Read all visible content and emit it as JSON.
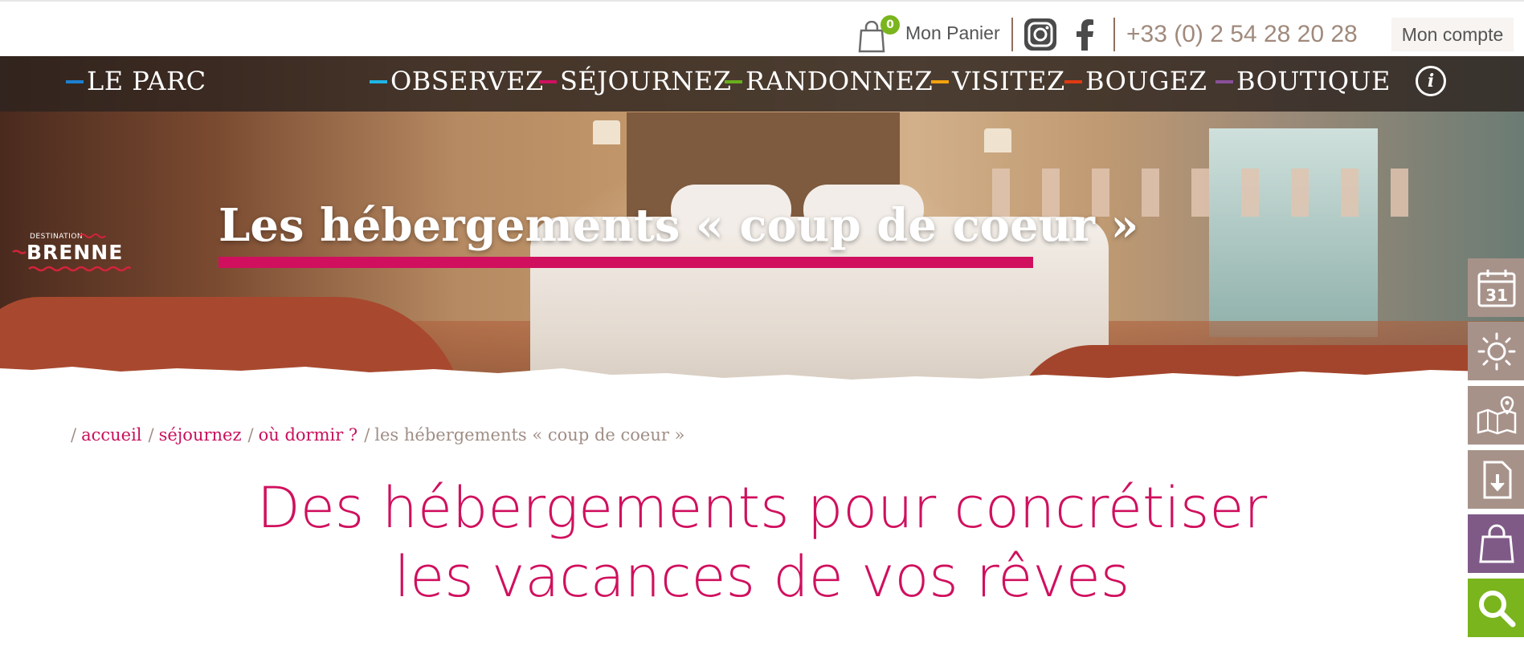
{
  "topbar": {
    "cart_count": "0",
    "cart_label": "Mon Panier",
    "social": [
      "instagram-icon",
      "facebook-icon"
    ],
    "phone": "+33 (0) 2 54 28 20 28",
    "account_label": "Mon compte"
  },
  "nav": {
    "items": [
      {
        "label": "LE PARC",
        "color": "#1c7fd1"
      },
      {
        "label": "OBSERVEZ",
        "color": "#1fb5e6"
      },
      {
        "label": "SÉJOURNEZ",
        "color": "#d0105e"
      },
      {
        "label": "RANDONNEZ",
        "color": "#6aad1c"
      },
      {
        "label": "VISITEZ",
        "color": "#f2a20d"
      },
      {
        "label": "BOUGEZ",
        "color": "#e03a12"
      },
      {
        "label": "BOUTIQUE",
        "color": "#8a4f9a"
      }
    ],
    "info_label": "i"
  },
  "logo": {
    "small": "DESTINATION",
    "big": "BRENNE"
  },
  "hero": {
    "title": "Les hébergements «  coup de coeur  »"
  },
  "breadcrumb": {
    "items": [
      "accueil",
      "séjournez",
      "où dormir ?"
    ],
    "current": "les hébergements «  coup de coeur  »"
  },
  "heading": {
    "line1": "Des hébergements pour concrétiser",
    "line2": "les vacances de vos rêves"
  },
  "sidebar": {
    "calendar_day": "31",
    "buttons": [
      "calendar-icon",
      "sun-icon",
      "map-icon",
      "download-icon",
      "shopping-bag-icon",
      "search-icon"
    ]
  },
  "colors": {
    "accent": "#d0105e",
    "shop": "#7f5a87",
    "search": "#7ab51d",
    "sidebar": "#a7928a"
  }
}
